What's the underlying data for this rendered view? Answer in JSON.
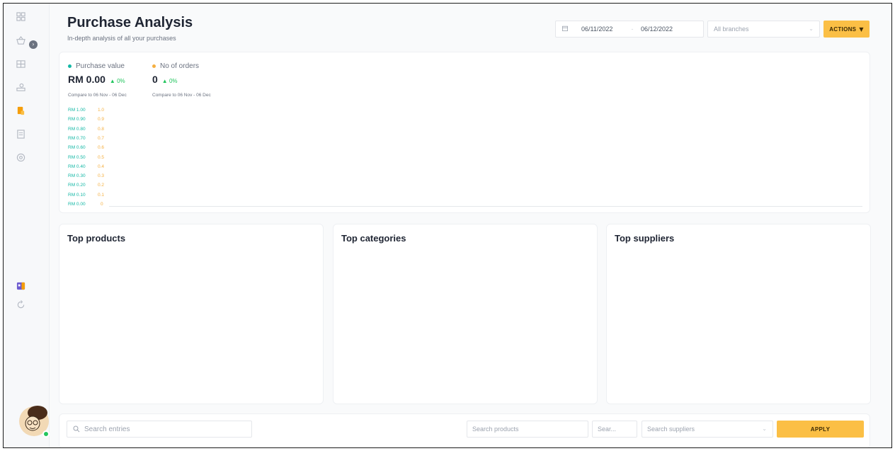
{
  "header": {
    "title": "Purchase Analysis",
    "subtitle": "In-depth analysis of all your purchases",
    "date_from": "06/11/2022",
    "date_to": "06/12/2022",
    "date_separator": "-",
    "branch_placeholder": "All branches",
    "actions_label": "ACTIONS"
  },
  "sidebar": {
    "icons": [
      "dashboard-icon",
      "basket-icon",
      "grid-icon",
      "money-icon",
      "purchase-icon",
      "receipt-icon",
      "settings-icon",
      "wallet-icon",
      "refresh-icon"
    ],
    "collapse_label": "›"
  },
  "summary": {
    "purchase_value": {
      "legend": "Purchase value",
      "value": "RM 0.00",
      "change": "0%",
      "compare": "Compare to 06 Nov - 06 Dec",
      "color": "#14b8a6"
    },
    "orders": {
      "legend": "No of orders",
      "value": "0",
      "change": "0%",
      "compare": "Compare to 06 Nov - 06 Dec",
      "color": "#f5b041"
    }
  },
  "chart_data": {
    "type": "line",
    "y_left_ticks": [
      "RM 1.00",
      "RM 0.90",
      "RM 0.80",
      "RM 0.70",
      "RM 0.60",
      "RM 0.50",
      "RM 0.40",
      "RM 0.30",
      "RM 0.20",
      "RM 0.10",
      "RM 0.00"
    ],
    "y_right_ticks": [
      "1.0",
      "0.9",
      "0.8",
      "0.7",
      "0.6",
      "0.5",
      "0.4",
      "0.3",
      "0.2",
      "0.1",
      "0"
    ],
    "ylim": [
      0,
      1
    ],
    "series": [
      {
        "name": "Purchase value",
        "values": []
      },
      {
        "name": "No of orders",
        "values": []
      }
    ]
  },
  "panels": {
    "top_products": "Top products",
    "top_categories": "Top categories",
    "top_suppliers": "Top suppliers"
  },
  "filters": {
    "search_entries_placeholder": "Search entries",
    "search_products_placeholder": "Search products",
    "search_short_placeholder": "Sear...",
    "search_suppliers_placeholder": "Search suppliers",
    "apply_label": "APPLY"
  }
}
